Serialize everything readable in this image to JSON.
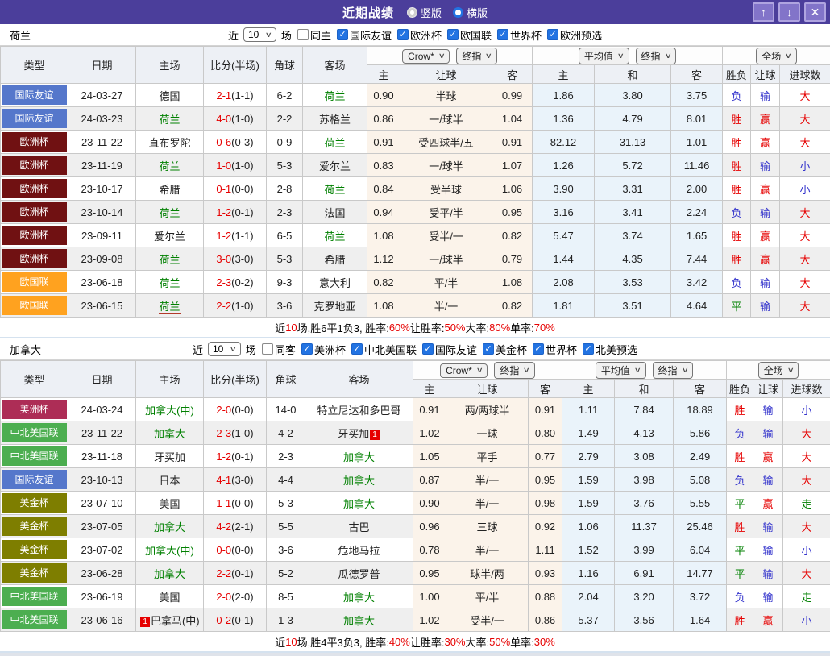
{
  "titlebar": {
    "title": "近期战绩",
    "radio_vertical": "竖版",
    "radio_horizontal": "横版"
  },
  "icons": {
    "chevron_down": "∨",
    "up_arrow": "↑",
    "down_arrow": "↓",
    "close": "✕",
    "check": "✓"
  },
  "columns": {
    "main": [
      "类型",
      "日期",
      "主场",
      "比分(半场)",
      "角球",
      "客场"
    ],
    "sub": [
      "主",
      "让球",
      "客",
      "主",
      "和",
      "客",
      "胜负",
      "让球",
      "进球数"
    ]
  },
  "colors": {
    "red": "#e60000",
    "blue": "#3333cc",
    "green": "#008000",
    "league": {
      "国际友谊": "#5577cb",
      "欧洲杯": "#701112",
      "欧国联": "#ffa21f",
      "美洲杯": "#ad2d56",
      "中北美国联": "#4cae50",
      "美金杯": "#7e7e00"
    }
  },
  "sections": [
    {
      "team": "荷兰",
      "filter": {
        "prefix": "近",
        "count": "10",
        "suffix": "场",
        "same": "同主",
        "same_checked": false,
        "leagues": [
          {
            "label": "国际友谊",
            "checked": true
          },
          {
            "label": "欧洲杯",
            "checked": true
          },
          {
            "label": "欧国联",
            "checked": true
          },
          {
            "label": "世界杯",
            "checked": true
          },
          {
            "label": "欧洲预选",
            "checked": true
          }
        ]
      },
      "dropdowns": [
        "Crow*",
        "终指",
        "平均值",
        "终指",
        "全场"
      ],
      "rows": [
        {
          "league": "国际友谊",
          "date": "24-03-27",
          "home": {
            "t": "德国"
          },
          "score": "2-1",
          "half": "(1-1)",
          "corner": "6-2",
          "away": {
            "t": "荷兰",
            "g": 1
          },
          "o1": "0.90",
          "hc": "半球",
          "o2": "0.99",
          "a1": "1.86",
          "a2": "3.80",
          "a3": "3.75",
          "r1": {
            "t": "负",
            "c": "blue"
          },
          "r2": {
            "t": "输",
            "c": "blue"
          },
          "r3": {
            "t": "大",
            "c": "red"
          }
        },
        {
          "league": "国际友谊",
          "date": "24-03-23",
          "home": {
            "t": "荷兰",
            "g": 1
          },
          "score": "4-0",
          "half": "(1-0)",
          "corner": "2-2",
          "away": {
            "t": "苏格兰"
          },
          "o1": "0.86",
          "hc": "一/球半",
          "o2": "1.04",
          "a1": "1.36",
          "a2": "4.79",
          "a3": "8.01",
          "r1": {
            "t": "胜",
            "c": "red"
          },
          "r2": {
            "t": "赢",
            "c": "red"
          },
          "r3": {
            "t": "大",
            "c": "red"
          }
        },
        {
          "league": "欧洲杯",
          "date": "23-11-22",
          "home": {
            "t": "直布罗陀"
          },
          "score": "0-6",
          "half": "(0-3)",
          "corner": "0-9",
          "away": {
            "t": "荷兰",
            "g": 1
          },
          "o1": "0.91",
          "hc": "受四球半/五",
          "o2": "0.91",
          "a1": "82.12",
          "a2": "31.13",
          "a3": "1.01",
          "r1": {
            "t": "胜",
            "c": "red"
          },
          "r2": {
            "t": "赢",
            "c": "red"
          },
          "r3": {
            "t": "大",
            "c": "red"
          }
        },
        {
          "league": "欧洲杯",
          "date": "23-11-19",
          "home": {
            "t": "荷兰",
            "g": 1
          },
          "score": "1-0",
          "half": "(1-0)",
          "corner": "5-3",
          "away": {
            "t": "爱尔兰"
          },
          "o1": "0.83",
          "hc": "一/球半",
          "o2": "1.07",
          "a1": "1.26",
          "a2": "5.72",
          "a3": "11.46",
          "r1": {
            "t": "胜",
            "c": "red"
          },
          "r2": {
            "t": "输",
            "c": "blue"
          },
          "r3": {
            "t": "小",
            "c": "blue"
          }
        },
        {
          "league": "欧洲杯",
          "date": "23-10-17",
          "home": {
            "t": "希腊"
          },
          "score": "0-1",
          "half": "(0-0)",
          "corner": "2-8",
          "away": {
            "t": "荷兰",
            "g": 1
          },
          "o1": "0.84",
          "hc": "受半球",
          "o2": "1.06",
          "a1": "3.90",
          "a2": "3.31",
          "a3": "2.00",
          "r1": {
            "t": "胜",
            "c": "red"
          },
          "r2": {
            "t": "赢",
            "c": "red"
          },
          "r3": {
            "t": "小",
            "c": "blue"
          }
        },
        {
          "league": "欧洲杯",
          "date": "23-10-14",
          "home": {
            "t": "荷兰",
            "g": 1
          },
          "score": "1-2",
          "half": "(0-1)",
          "corner": "2-3",
          "away": {
            "t": "法国"
          },
          "o1": "0.94",
          "hc": "受平/半",
          "o2": "0.95",
          "a1": "3.16",
          "a2": "3.41",
          "a3": "2.24",
          "r1": {
            "t": "负",
            "c": "blue"
          },
          "r2": {
            "t": "输",
            "c": "blue"
          },
          "r3": {
            "t": "大",
            "c": "red"
          }
        },
        {
          "league": "欧洲杯",
          "date": "23-09-11",
          "home": {
            "t": "爱尔兰"
          },
          "score": "1-2",
          "half": "(1-1)",
          "corner": "6-5",
          "away": {
            "t": "荷兰",
            "g": 1
          },
          "o1": "1.08",
          "hc": "受半/一",
          "o2": "0.82",
          "a1": "5.47",
          "a2": "3.74",
          "a3": "1.65",
          "r1": {
            "t": "胜",
            "c": "red"
          },
          "r2": {
            "t": "赢",
            "c": "red"
          },
          "r3": {
            "t": "大",
            "c": "red"
          }
        },
        {
          "league": "欧洲杯",
          "date": "23-09-08",
          "home": {
            "t": "荷兰",
            "g": 1
          },
          "score": "3-0",
          "half": "(3-0)",
          "corner": "5-3",
          "away": {
            "t": "希腊"
          },
          "o1": "1.12",
          "hc": "一/球半",
          "o2": "0.79",
          "a1": "1.44",
          "a2": "4.35",
          "a3": "7.44",
          "r1": {
            "t": "胜",
            "c": "red"
          },
          "r2": {
            "t": "赢",
            "c": "red"
          },
          "r3": {
            "t": "大",
            "c": "red"
          }
        },
        {
          "league": "欧国联",
          "date": "23-06-18",
          "home": {
            "t": "荷兰",
            "g": 1
          },
          "score": "2-3",
          "half": "(0-2)",
          "corner": "9-3",
          "away": {
            "t": "意大利"
          },
          "o1": "0.82",
          "hc": "平/半",
          "o2": "1.08",
          "a1": "2.08",
          "a2": "3.53",
          "a3": "3.42",
          "r1": {
            "t": "负",
            "c": "blue"
          },
          "r2": {
            "t": "输",
            "c": "blue"
          },
          "r3": {
            "t": "大",
            "c": "red"
          }
        },
        {
          "league": "欧国联",
          "date": "23-06-15",
          "home": {
            "t": "荷兰",
            "g": 1,
            "u": 1
          },
          "score": "2-2",
          "half": "(1-0)",
          "corner": "3-6",
          "away": {
            "t": "克罗地亚"
          },
          "o1": "1.08",
          "hc": "半/一",
          "o2": "0.82",
          "a1": "1.81",
          "a2": "3.51",
          "a3": "4.64",
          "r1": {
            "t": "平",
            "c": "green"
          },
          "r2": {
            "t": "输",
            "c": "blue"
          },
          "r3": {
            "t": "大",
            "c": "red"
          }
        }
      ],
      "summary": [
        {
          "t": "近"
        },
        {
          "t": "10",
          "red": true
        },
        {
          "t": "场,胜6平1负3, 胜率:"
        },
        {
          "t": "60%",
          "red": true
        },
        {
          "t": " 让胜率:"
        },
        {
          "t": "50%",
          "red": true
        },
        {
          "t": " 大率:"
        },
        {
          "t": "80%",
          "red": true
        },
        {
          "t": " 单率:"
        },
        {
          "t": "70%",
          "red": true
        }
      ]
    },
    {
      "team": "加拿大",
      "filter": {
        "prefix": "近",
        "count": "10",
        "suffix": "场",
        "same": "同客",
        "same_checked": false,
        "leagues": [
          {
            "label": "美洲杯",
            "checked": true
          },
          {
            "label": "中北美国联",
            "checked": true
          },
          {
            "label": "国际友谊",
            "checked": true
          },
          {
            "label": "美金杯",
            "checked": true
          },
          {
            "label": "世界杯",
            "checked": true
          },
          {
            "label": "北美预选",
            "checked": true
          }
        ]
      },
      "dropdowns": [
        "Crow*",
        "终指",
        "平均值",
        "终指",
        "全场"
      ],
      "rows": [
        {
          "league": "美洲杯",
          "date": "24-03-24",
          "home": {
            "t": "加拿大(中)",
            "g": 1
          },
          "score": "2-0",
          "half": "(0-0)",
          "corner": "14-0",
          "away": {
            "t": "特立尼达和多巴哥"
          },
          "o1": "0.91",
          "hc": "两/两球半",
          "o2": "0.91",
          "a1": "1.11",
          "a2": "7.84",
          "a3": "18.89",
          "r1": {
            "t": "胜",
            "c": "red"
          },
          "r2": {
            "t": "输",
            "c": "blue"
          },
          "r3": {
            "t": "小",
            "c": "blue"
          }
        },
        {
          "league": "中北美国联",
          "date": "23-11-22",
          "home": {
            "t": "加拿大",
            "g": 1
          },
          "score": "2-3",
          "half": "(1-0)",
          "corner": "4-2",
          "away": {
            "t": "牙买加",
            "badge": "1",
            "bp": "after"
          },
          "o1": "1.02",
          "hc": "一球",
          "o2": "0.80",
          "a1": "1.49",
          "a2": "4.13",
          "a3": "5.86",
          "r1": {
            "t": "负",
            "c": "blue"
          },
          "r2": {
            "t": "输",
            "c": "blue"
          },
          "r3": {
            "t": "大",
            "c": "red"
          }
        },
        {
          "league": "中北美国联",
          "date": "23-11-18",
          "home": {
            "t": "牙买加"
          },
          "score": "1-2",
          "half": "(0-1)",
          "corner": "2-3",
          "away": {
            "t": "加拿大",
            "g": 1
          },
          "o1": "1.05",
          "hc": "平手",
          "o2": "0.77",
          "a1": "2.79",
          "a2": "3.08",
          "a3": "2.49",
          "r1": {
            "t": "胜",
            "c": "red"
          },
          "r2": {
            "t": "赢",
            "c": "red"
          },
          "r3": {
            "t": "大",
            "c": "red"
          }
        },
        {
          "league": "国际友谊",
          "date": "23-10-13",
          "home": {
            "t": "日本"
          },
          "score": "4-1",
          "half": "(3-0)",
          "corner": "4-4",
          "away": {
            "t": "加拿大",
            "g": 1
          },
          "o1": "0.87",
          "hc": "半/一",
          "o2": "0.95",
          "a1": "1.59",
          "a2": "3.98",
          "a3": "5.08",
          "r1": {
            "t": "负",
            "c": "blue"
          },
          "r2": {
            "t": "输",
            "c": "blue"
          },
          "r3": {
            "t": "大",
            "c": "red"
          }
        },
        {
          "league": "美金杯",
          "date": "23-07-10",
          "home": {
            "t": "美国"
          },
          "score": "1-1",
          "half": "(0-0)",
          "corner": "5-3",
          "away": {
            "t": "加拿大",
            "g": 1
          },
          "o1": "0.90",
          "hc": "半/一",
          "o2": "0.98",
          "a1": "1.59",
          "a2": "3.76",
          "a3": "5.55",
          "r1": {
            "t": "平",
            "c": "green"
          },
          "r2": {
            "t": "赢",
            "c": "red"
          },
          "r3": {
            "t": "走",
            "c": "green"
          }
        },
        {
          "league": "美金杯",
          "date": "23-07-05",
          "home": {
            "t": "加拿大",
            "g": 1
          },
          "score": "4-2",
          "half": "(2-1)",
          "corner": "5-5",
          "away": {
            "t": "古巴"
          },
          "o1": "0.96",
          "hc": "三球",
          "o2": "0.92",
          "a1": "1.06",
          "a2": "11.37",
          "a3": "25.46",
          "r1": {
            "t": "胜",
            "c": "red"
          },
          "r2": {
            "t": "输",
            "c": "blue"
          },
          "r3": {
            "t": "大",
            "c": "red"
          }
        },
        {
          "league": "美金杯",
          "date": "23-07-02",
          "home": {
            "t": "加拿大(中)",
            "g": 1
          },
          "score": "0-0",
          "half": "(0-0)",
          "corner": "3-6",
          "away": {
            "t": "危地马拉"
          },
          "o1": "0.78",
          "hc": "半/一",
          "o2": "1.11",
          "a1": "1.52",
          "a2": "3.99",
          "a3": "6.04",
          "r1": {
            "t": "平",
            "c": "green"
          },
          "r2": {
            "t": "输",
            "c": "blue"
          },
          "r3": {
            "t": "小",
            "c": "blue"
          }
        },
        {
          "league": "美金杯",
          "date": "23-06-28",
          "home": {
            "t": "加拿大",
            "g": 1
          },
          "score": "2-2",
          "half": "(0-1)",
          "corner": "5-2",
          "away": {
            "t": "瓜德罗普"
          },
          "o1": "0.95",
          "hc": "球半/两",
          "o2": "0.93",
          "a1": "1.16",
          "a2": "6.91",
          "a3": "14.77",
          "r1": {
            "t": "平",
            "c": "green"
          },
          "r2": {
            "t": "输",
            "c": "blue"
          },
          "r3": {
            "t": "大",
            "c": "red"
          }
        },
        {
          "league": "中北美国联",
          "date": "23-06-19",
          "home": {
            "t": "美国"
          },
          "score": "2-0",
          "half": "(2-0)",
          "corner": "8-5",
          "away": {
            "t": "加拿大",
            "g": 1
          },
          "o1": "1.00",
          "hc": "平/半",
          "o2": "0.88",
          "a1": "2.04",
          "a2": "3.20",
          "a3": "3.72",
          "r1": {
            "t": "负",
            "c": "blue"
          },
          "r2": {
            "t": "输",
            "c": "blue"
          },
          "r3": {
            "t": "走",
            "c": "green"
          }
        },
        {
          "league": "中北美国联",
          "date": "23-06-16",
          "home": {
            "t": "巴拿马(中)",
            "badge": "1",
            "bp": "before"
          },
          "score": "0-2",
          "half": "(0-1)",
          "corner": "1-3",
          "away": {
            "t": "加拿大",
            "g": 1
          },
          "o1": "1.02",
          "hc": "受半/一",
          "o2": "0.86",
          "a1": "5.37",
          "a2": "3.56",
          "a3": "1.64",
          "r1": {
            "t": "胜",
            "c": "red"
          },
          "r2": {
            "t": "赢",
            "c": "red"
          },
          "r3": {
            "t": "小",
            "c": "blue"
          }
        }
      ],
      "summary": [
        {
          "t": "近"
        },
        {
          "t": "10",
          "red": true
        },
        {
          "t": "场,胜4平3负3, 胜率:"
        },
        {
          "t": "40%",
          "red": true
        },
        {
          "t": " 让胜率:"
        },
        {
          "t": "30%",
          "red": true
        },
        {
          "t": " 大率:"
        },
        {
          "t": "50%",
          "red": true
        },
        {
          "t": " 单率:"
        },
        {
          "t": "30%",
          "red": true
        }
      ]
    }
  ]
}
